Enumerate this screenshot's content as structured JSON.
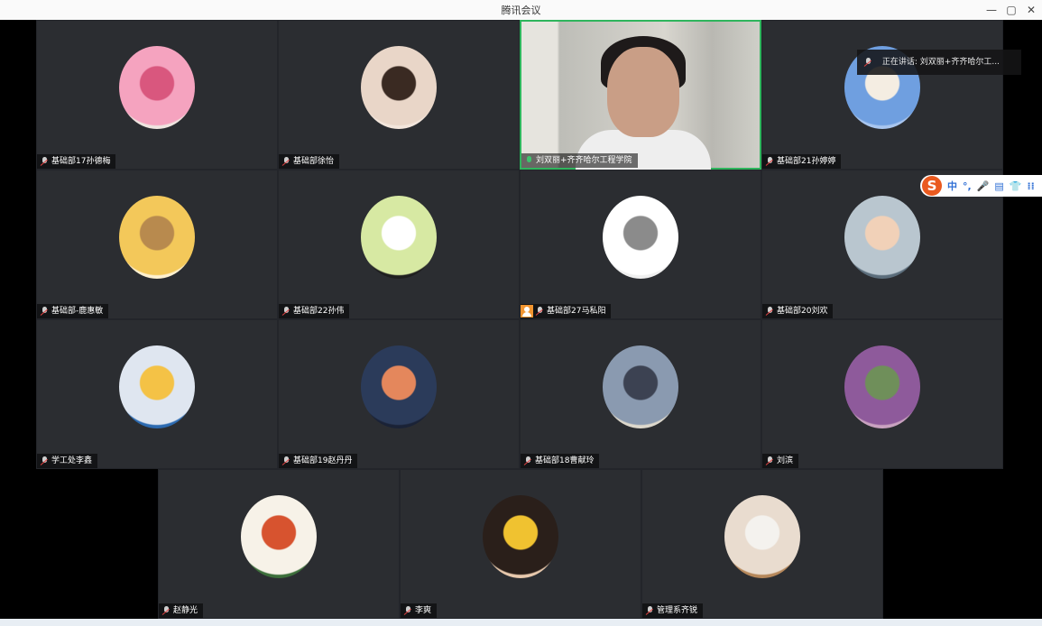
{
  "window": {
    "title": "腾讯会议",
    "minimize": "—",
    "restore": "▢",
    "close": "✕"
  },
  "speaking": {
    "prefix": "正在讲话:",
    "name": "刘双丽+齐齐哈尔工..."
  },
  "ime": {
    "logo": "S",
    "items": [
      "中",
      "°,",
      "🎤",
      "▤",
      "👕",
      "⁞⁞"
    ]
  },
  "participants": [
    {
      "name": "基础部17孙德梅",
      "colors": [
        "#f5a3bf",
        "#d9577e",
        "#efe5e0"
      ]
    },
    {
      "name": "基础部徐怡",
      "colors": [
        "#e9d6c8",
        "#3a2a22",
        "#f3e6dc"
      ]
    },
    {
      "name": "刘双丽+齐齐哈尔工程学院",
      "speaking": true
    },
    {
      "name": "基础部21孙婷婷",
      "colors": [
        "#6f9fe0",
        "#f4ede2",
        "#a9c6ef"
      ]
    },
    {
      "name": "基础部-鹿惠敏",
      "colors": [
        "#f3c85a",
        "#b88a4e",
        "#fff1d0"
      ]
    },
    {
      "name": "基础部22孙伟",
      "colors": [
        "#d7e9a3",
        "#ffffff",
        "#1f1f1f"
      ]
    },
    {
      "name": "基础部27马私阳",
      "colors": [
        "#ffffff",
        "#8b8b8b",
        "#efefef"
      ],
      "host": true
    },
    {
      "name": "基础部20刘欢",
      "colors": [
        "#b9c6cf",
        "#f1d1b8",
        "#5b6d7b"
      ]
    },
    {
      "name": "学工处李鑫",
      "colors": [
        "#dfe6f0",
        "#f4c246",
        "#2c6ab0"
      ]
    },
    {
      "name": "基础部19赵丹丹",
      "colors": [
        "#2b3b5a",
        "#e4875c",
        "#1a2236"
      ]
    },
    {
      "name": "基础部18曹献玲",
      "colors": [
        "#8a9ab0",
        "#3c4252",
        "#ddd8cc"
      ]
    },
    {
      "name": "刘滨",
      "colors": [
        "#8e5a9b",
        "#6f8f5a",
        "#c9a2c0"
      ]
    },
    {
      "name": "赵静光",
      "colors": [
        "#f7f2e8",
        "#d7532f",
        "#3c6e3a"
      ]
    },
    {
      "name": "李爽",
      "colors": [
        "#2a1f1a",
        "#f0c230",
        "#e8c9ad"
      ]
    },
    {
      "name": "管理系齐锐",
      "colors": [
        "#e9dccf",
        "#f4f2ee",
        "#b5875a"
      ]
    }
  ]
}
